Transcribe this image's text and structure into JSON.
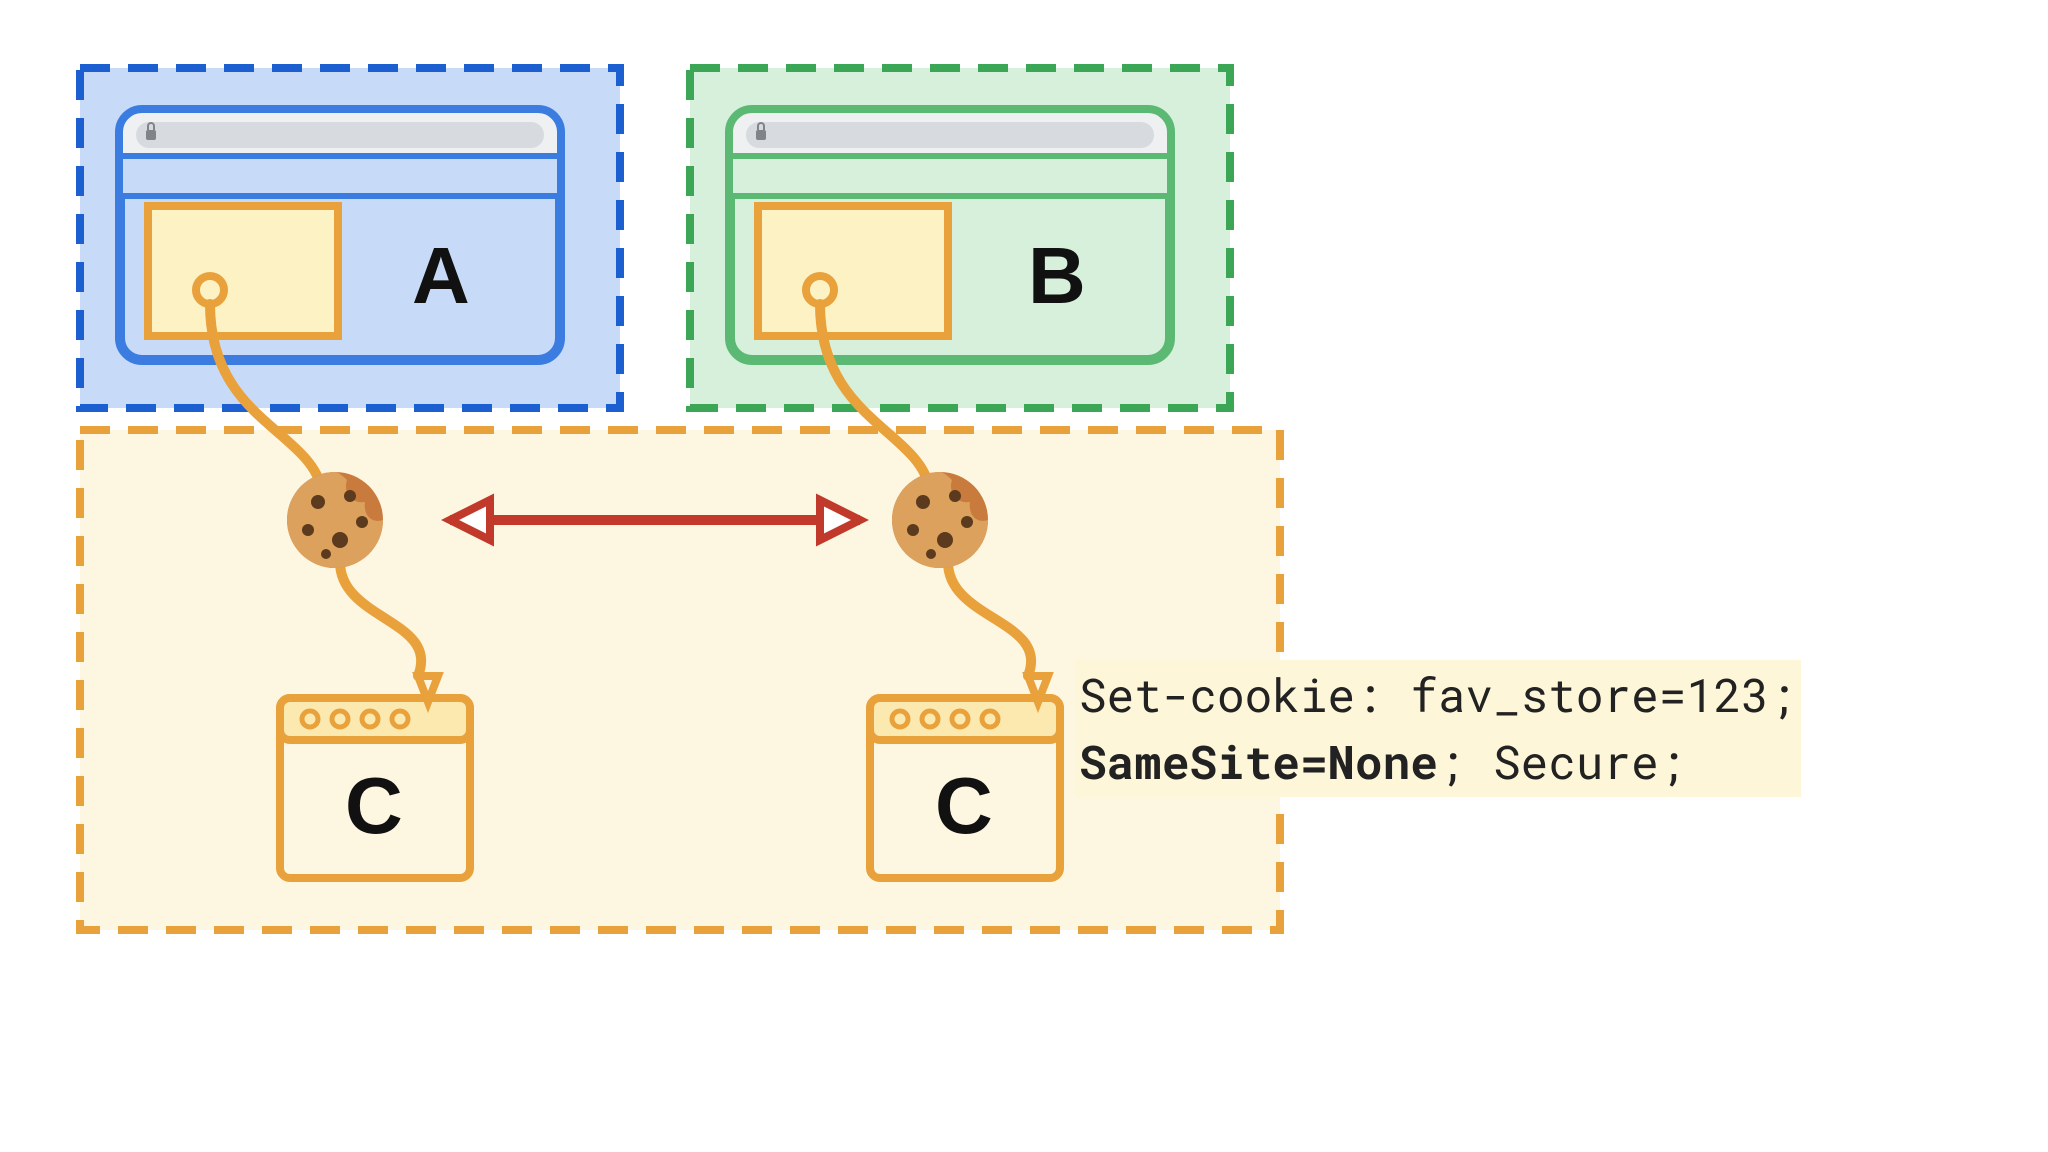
{
  "sites": {
    "a": {
      "label": "A"
    },
    "b": {
      "label": "B"
    },
    "c_left": {
      "label": "C"
    },
    "c_right": {
      "label": "C"
    }
  },
  "code": {
    "line1_prefix": "Set-cookie: fav_store=123;",
    "line2_bold": "SameSite=None",
    "line2_rest": "; Secure;"
  },
  "colors": {
    "blue_border": "#1C5FD1",
    "blue_fill": "#C7DBF8",
    "blue_stroke": "#3A7CE0",
    "green_border": "#3CA657",
    "green_fill": "#D6F0DB",
    "green_stroke": "#5CB974",
    "orange_border": "#F5A623",
    "orange_fill": "#FBE9B0",
    "orange_fill_light": "#FDF6E0",
    "orange_stroke": "#E9A13B",
    "cream": "#FDF2C4",
    "red": "#C1392B",
    "grey": "#D7DBDF",
    "grey_light": "#EEF0F2",
    "cookie_body": "#C97A3D",
    "cookie_dark": "#5B3A1E"
  }
}
